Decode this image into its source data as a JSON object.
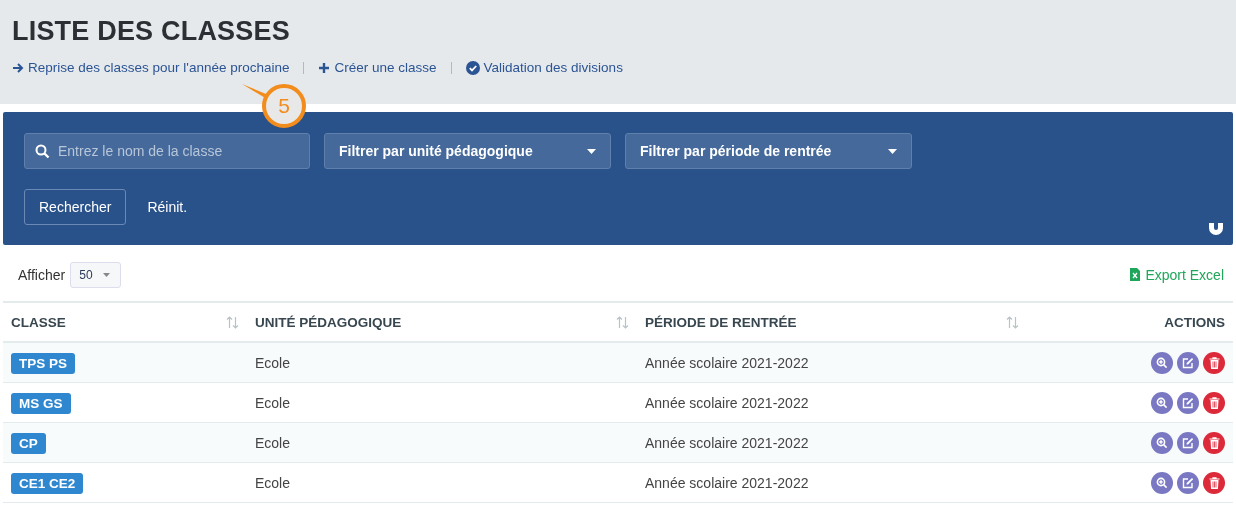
{
  "page_title": "LISTE DES CLASSES",
  "actions": [
    {
      "kind": "arrow",
      "label": "Reprise des classes pour l'année prochaine"
    },
    {
      "kind": "plus",
      "label": "Créer une classe"
    },
    {
      "kind": "check",
      "label": "Validation des divisions"
    }
  ],
  "callout": {
    "label": "5"
  },
  "filters": {
    "search": {
      "placeholder": "Entrez le nom de la classe"
    },
    "selects": [
      "Filtrer par unité pédagogique",
      "Filtrer par période de rentrée"
    ],
    "buttons": [
      {
        "kind": "outline",
        "label": "Rechercher"
      },
      {
        "kind": "plain",
        "label": "Réinit."
      }
    ]
  },
  "page_size": {
    "label": "Afficher",
    "value": "50"
  },
  "export": {
    "label": "Export Excel"
  },
  "table": {
    "columns": [
      {
        "label": "CLASSE",
        "sortable": true
      },
      {
        "label": "UNITÉ PÉDAGOGIQUE",
        "sortable": true
      },
      {
        "label": "PÉRIODE DE RENTRÉE",
        "sortable": true
      },
      {
        "label": "ACTIONS",
        "sortable": false
      }
    ],
    "rows": [
      {
        "classe": "TPS PS",
        "unite": "Ecole",
        "periode": "Année scolaire 2021-2022"
      },
      {
        "classe": "MS GS",
        "unite": "Ecole",
        "periode": "Année scolaire 2021-2022"
      },
      {
        "classe": "CP",
        "unite": "Ecole",
        "periode": "Année scolaire 2021-2022"
      },
      {
        "classe": "CE1 CE2",
        "unite": "Ecole",
        "periode": "Année scolaire 2021-2022"
      }
    ]
  }
}
